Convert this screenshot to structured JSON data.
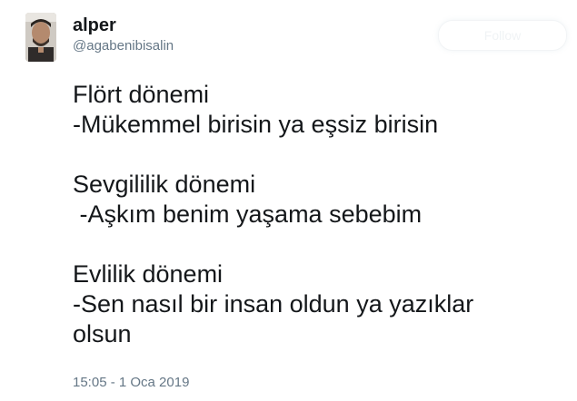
{
  "tweet": {
    "user": {
      "display_name": "alper",
      "handle": "@agabenibisalin"
    },
    "follow_label": "Follow",
    "lines": [
      "Flört dönemi",
      "-Mükemmel birisin ya eşsiz birisin",
      "",
      "Sevgililik dönemi",
      " -Aşkım benim yaşama sebebim",
      "",
      "Evlilik dönemi",
      "-Sen nasıl bir insan oldun ya yazıklar",
      "olsun"
    ],
    "timestamp": "15:05 - 1 Oca 2019"
  },
  "colors": {
    "text": "#14171a",
    "secondary": "#657786",
    "background": "#ffffff"
  }
}
